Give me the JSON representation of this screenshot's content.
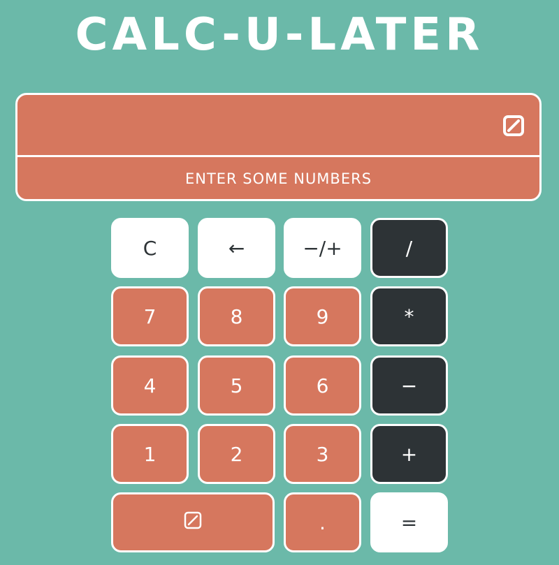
{
  "app": {
    "title": "CALC-U-LATER"
  },
  "display": {
    "value": "",
    "message": "ENTER SOME NUMBERS",
    "icon": "clear-entry-icon"
  },
  "keys": {
    "clear": "C",
    "backspace": "←",
    "negate": "−/+",
    "divide": "/",
    "seven": "7",
    "eight": "8",
    "nine": "9",
    "multiply": "*",
    "four": "4",
    "five": "5",
    "six": "6",
    "subtract": "−",
    "one": "1",
    "two": "2",
    "three": "3",
    "add": "+",
    "zero_icon": "slashed-zero-icon",
    "decimal": ".",
    "equals": "="
  },
  "colors": {
    "background": "#6bb9a9",
    "display": "#d6775e",
    "number_key": "#d6775e",
    "operator_key": "#2d3336",
    "light_key": "#ffffff"
  }
}
